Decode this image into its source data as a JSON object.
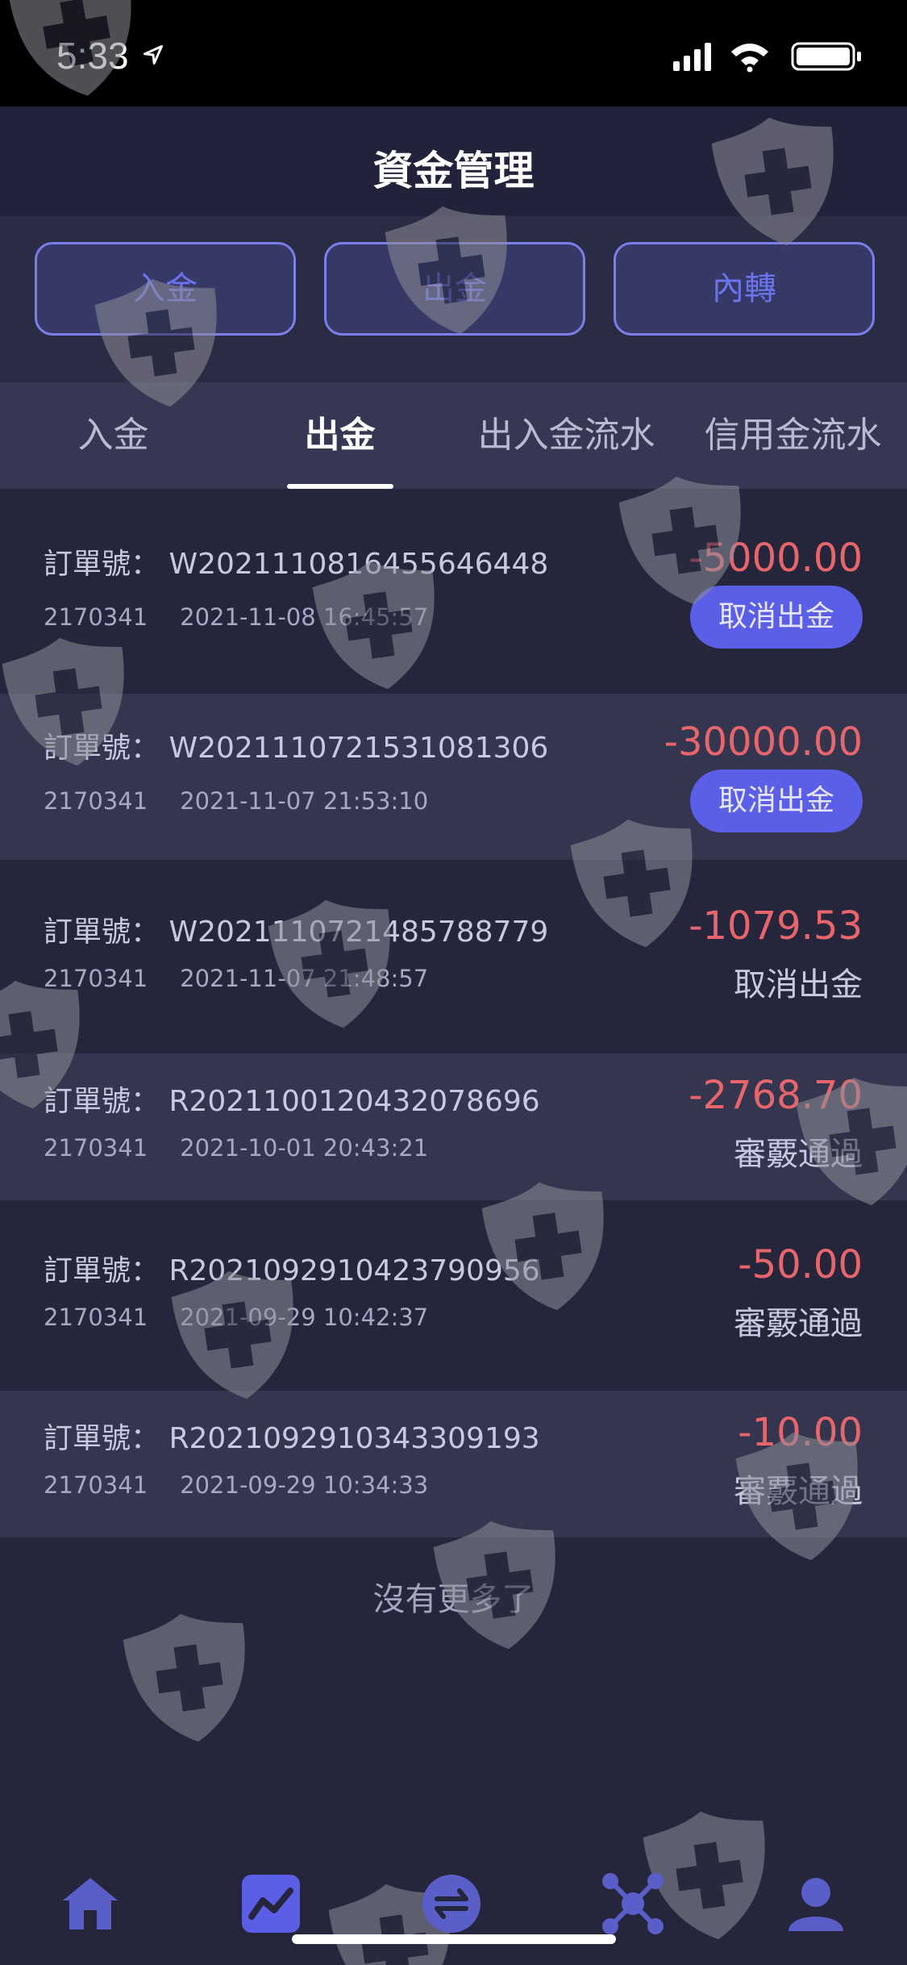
{
  "status_bar": {
    "time": "5:33"
  },
  "header": {
    "title": "資金管理"
  },
  "actions": [
    {
      "label": "入金"
    },
    {
      "label": "出金"
    },
    {
      "label": "內轉"
    }
  ],
  "tabs": [
    {
      "label": "入金"
    },
    {
      "label": "出金"
    },
    {
      "label": "出入金流水"
    },
    {
      "label": "信用金流水"
    }
  ],
  "active_tab": "出金",
  "orders": [
    {
      "label": "訂單號：",
      "number": "W2021110816455646448",
      "account": "2170341",
      "datetime": "2021-11-08 16:45:57",
      "amount": "-5000.00",
      "action": "取消出金"
    },
    {
      "label": "訂單號：",
      "number": "W2021110721531081306",
      "account": "2170341",
      "datetime": "2021-11-07 21:53:10",
      "amount": "-30000.00",
      "action": "取消出金"
    },
    {
      "label": "訂單號：",
      "number": "W2021110721485788779",
      "account": "2170341",
      "datetime": "2021-11-07 21:48:57",
      "amount": "-1079.53",
      "status": "取消出金"
    },
    {
      "label": "訂單號：",
      "number": "R2021100120432078696",
      "account": "2170341",
      "datetime": "2021-10-01 20:43:21",
      "amount": "-2768.70",
      "status": "審覈通過"
    },
    {
      "label": "訂單號：",
      "number": "R2021092910423790956",
      "account": "2170341",
      "datetime": "2021-09-29 10:42:37",
      "amount": "-50.00",
      "status": "審覈通過"
    },
    {
      "label": "訂單號：",
      "number": "R2021092910343309193",
      "account": "2170341",
      "datetime": "2021-09-29 10:34:33",
      "amount": "-10.00",
      "status": "審覈通過"
    }
  ],
  "footer": {
    "no_more": "沒有更多了"
  },
  "tab_bar": [
    {
      "icon": "home-icon"
    },
    {
      "icon": "chart-icon"
    },
    {
      "icon": "exchange-icon"
    },
    {
      "icon": "network-icon"
    },
    {
      "icon": "user-icon"
    }
  ],
  "colors": {
    "accent": "#5b5ee6",
    "negative": "#e8656b",
    "background": "#25263c"
  }
}
